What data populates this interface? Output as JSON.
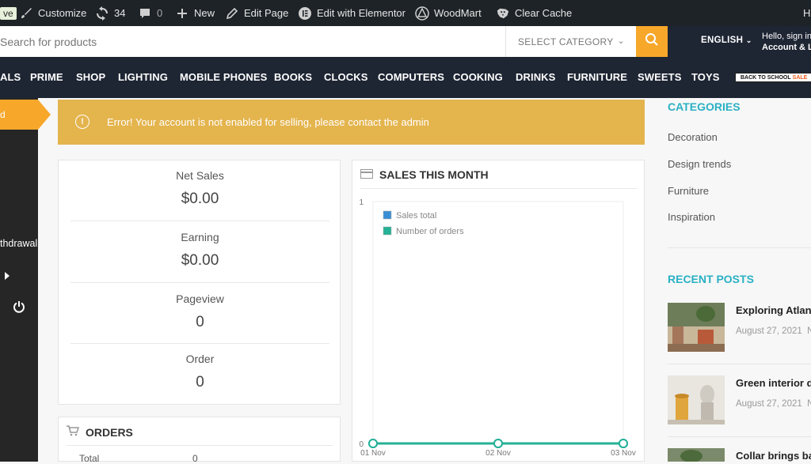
{
  "adminbar": {
    "live_label": "ve",
    "customize": "Customize",
    "updates_count": "34",
    "comments_count": "0",
    "new": "New",
    "edit_page": "Edit Page",
    "edit_elementor": "Edit with Elementor",
    "woodmart": "WoodMart",
    "clear_cache": "Clear Cache",
    "howdy": "H"
  },
  "search": {
    "placeholder": "Search for products",
    "category": "SELECT CATEGORY"
  },
  "header": {
    "language": "ENGLISH",
    "account_line1": "Hello, sign in",
    "account_line2": "Account & Lists"
  },
  "nav": {
    "items": [
      "ALS",
      "PRIME",
      "SHOP",
      "LIGHTING",
      "MOBILE PHONES",
      "BOOKS",
      "CLOCKS",
      "COMPUTERS",
      "COOKING",
      "DRINKS",
      "FURNITURE",
      "SWEETS",
      "TOYS"
    ],
    "promo": "BACK TO SCHOOL",
    "promo_highlight": "SALE"
  },
  "sidebar": {
    "active_label": "d",
    "withdrawal": "thdrawal"
  },
  "notice": {
    "text": "Error!  Your account is not enabled for selling, please contact the admin"
  },
  "stats": {
    "items": [
      {
        "label": "Net Sales",
        "value": "$0.00"
      },
      {
        "label": "Earning",
        "value": "$0.00"
      },
      {
        "label": "Pageview",
        "value": "0"
      },
      {
        "label": "Order",
        "value": "0"
      }
    ]
  },
  "sales": {
    "title": "SALES THIS MONTH"
  },
  "chart_data": {
    "type": "line",
    "title": "SALES THIS MONTH",
    "x": [
      "01 Nov",
      "02 Nov",
      "03 Nov"
    ],
    "series": [
      {
        "name": "Sales total",
        "values": [
          0,
          0,
          0
        ],
        "color": "#3a8fd4"
      },
      {
        "name": "Number of orders",
        "values": [
          0,
          0,
          0
        ],
        "color": "#25b195"
      }
    ],
    "ylim": [
      0,
      1
    ],
    "y_ticks": [
      "0",
      "1"
    ],
    "legend": "top-left",
    "grid": false
  },
  "orders": {
    "title": "ORDERS",
    "total_label": "Total",
    "total_value": "0"
  },
  "widgets": {
    "categories_title": "CATEGORIES",
    "categories": [
      "Decoration",
      "Design trends",
      "Furniture",
      "Inspiration"
    ],
    "recent_title": "RECENT POSTS",
    "posts": [
      {
        "title": "Exploring Atlanta",
        "date": "August 27, 2021",
        "extra": "N"
      },
      {
        "title": "Green interior de",
        "date": "August 27, 2021",
        "extra": "N"
      },
      {
        "title": "Collar brings bac",
        "date": "",
        "extra": ""
      }
    ]
  },
  "colors": {
    "accent": "#f7a72a",
    "nav_bg": "#1e2533",
    "notice_bg": "#e4b44d",
    "widget_title": "#2ab0c4"
  }
}
